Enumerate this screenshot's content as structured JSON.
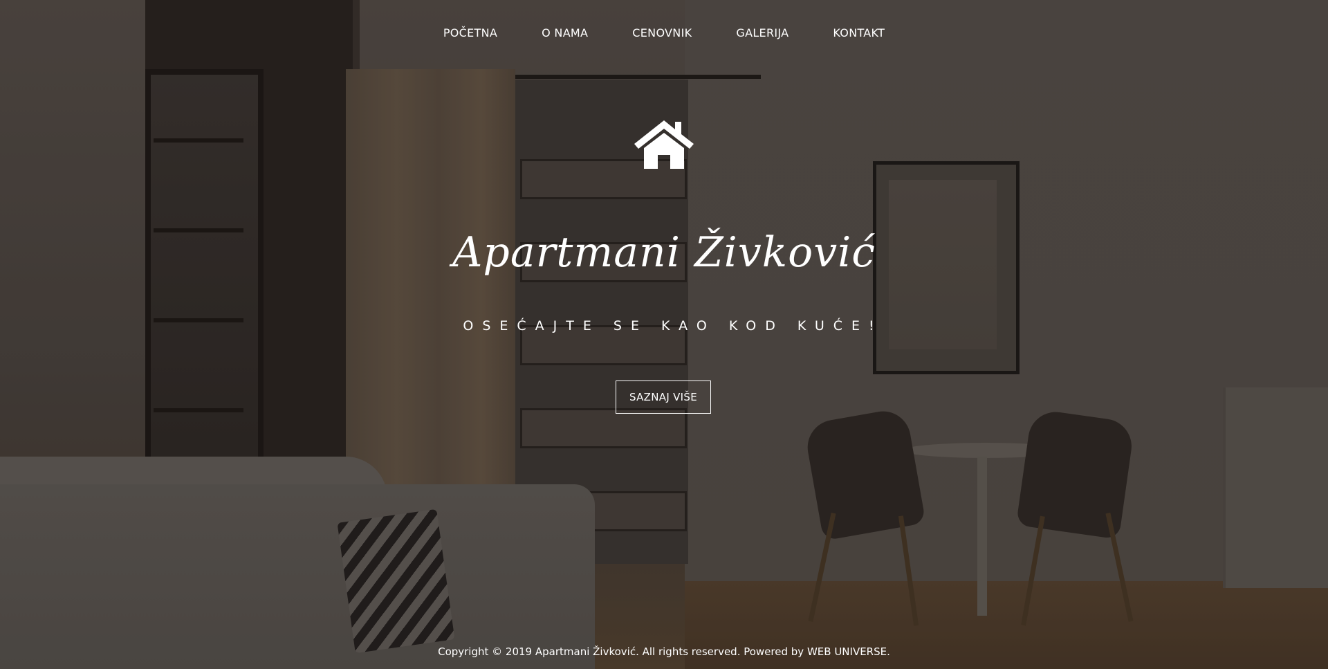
{
  "nav": {
    "items": [
      {
        "label": "POČETNA"
      },
      {
        "label": "O NAMA"
      },
      {
        "label": "CENOVNIK"
      },
      {
        "label": "GALERIJA"
      },
      {
        "label": "KONTAKT"
      }
    ]
  },
  "hero": {
    "icon": "home-icon",
    "title": "Apartmani Živković",
    "subtitle": "OSEĆAJTE SE KAO KOD KUĆE!",
    "button_label": "SAZNAJ VIŠE"
  },
  "footer": {
    "text_prefix": "Copyright © 2019 Apartmani Živković. All rights reserved. Powered by",
    "link_label": "WEB UNIVERSE",
    "text_suffix": "."
  },
  "colors": {
    "text": "#ffffff",
    "overlay": "#2a2220"
  }
}
